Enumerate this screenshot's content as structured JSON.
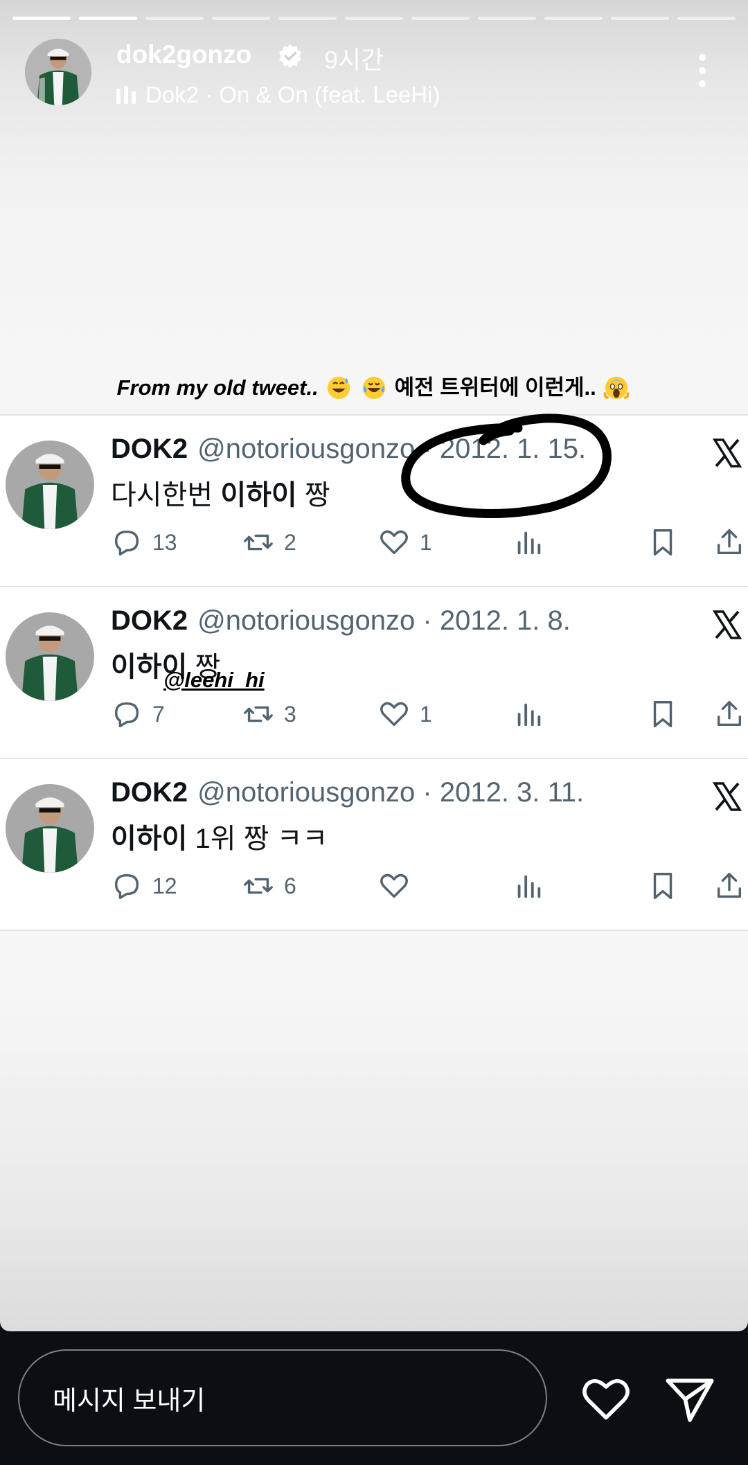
{
  "story": {
    "username": "dok2gonzo",
    "time": "9시간",
    "music": "Dok2 · On & On (feat. LeeHi)",
    "progress_segments": 11,
    "progress_done": 2
  },
  "caption": {
    "english": "From my old tweet..",
    "korean": "예전 트위터에 이런게..",
    "emojis": [
      "grinning-sweat-emoji",
      "tears-of-joy-emoji",
      "screaming-emoji"
    ]
  },
  "mention": "@leehi_hi",
  "tweets": [
    {
      "name": "DOK2",
      "handle": "@notoriousgonzo",
      "date": "· 2012. 1. 15.",
      "text_plain": "다시한번 ",
      "text_bold": "이하이",
      "text_after": " 짱",
      "replies": "13",
      "retweets": "2",
      "likes": "1"
    },
    {
      "name": "DOK2",
      "handle": "@notoriousgonzo",
      "date": "· 2012. 1. 8.",
      "text_plain": "",
      "text_bold": "이하이",
      "text_after": " 짱",
      "replies": "7",
      "retweets": "3",
      "likes": "1"
    },
    {
      "name": "DOK2",
      "handle": "@notoriousgonzo",
      "date": "· 2012. 3. 11.",
      "text_plain": "",
      "text_bold": "이하이",
      "text_after": " 1위 짱 ㅋㅋ",
      "replies": "12",
      "retweets": "6",
      "likes": ""
    }
  ],
  "bottom_bar": {
    "message_placeholder": "메시지 보내기"
  }
}
